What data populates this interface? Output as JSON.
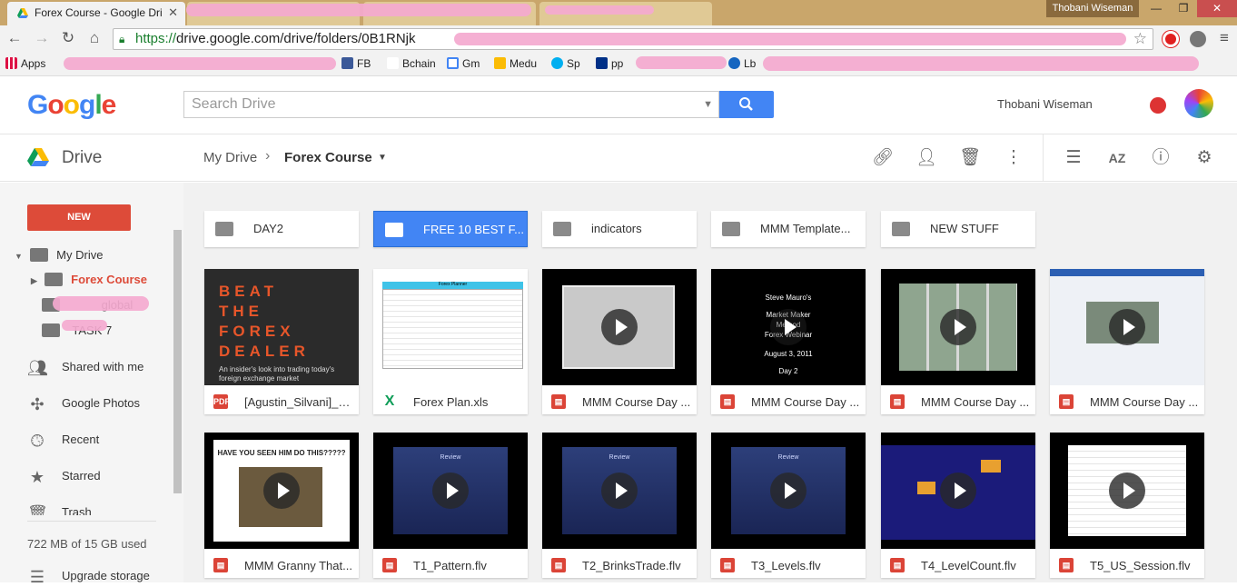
{
  "browser": {
    "active_tab_title": "Forex Course - Google Dri",
    "window_user": "Thobani Wiseman",
    "url_secure": "https://",
    "url_rest": "drive.google.com/drive/folders/0B1RNjk",
    "bookmarks_apps": "Apps",
    "bookmarks": [
      "FB",
      "Bchain",
      "Gm",
      "Medu",
      "Sp",
      "pp",
      "Lb"
    ]
  },
  "header": {
    "logo": "Google",
    "search_placeholder": "Search Drive",
    "user_name": "Thobani Wiseman"
  },
  "drive": {
    "product_label": "Drive",
    "breadcrumb_root": "My Drive",
    "breadcrumb_current": "Forex Course"
  },
  "sidebar": {
    "new_label": "NEW",
    "tree_root": "My Drive",
    "tree_current": "Forex Course",
    "tree_child2": "global",
    "tree_child3": "TASK 7",
    "items": [
      "Shared with me",
      "Google Photos",
      "Recent",
      "Starred",
      "Trash"
    ],
    "storage_text": "722 MB of 15 GB used",
    "upgrade_label": "Upgrade storage"
  },
  "folders": [
    "DAY2",
    "FREE 10 BEST F...",
    "indicators",
    "MMM Template...",
    "NEW STUFF"
  ],
  "files_row1": [
    "[Agustin_Silvani]_B...",
    "Forex Plan.xls",
    "MMM Course Day ...",
    "MMM Course Day ...",
    "MMM Course Day ...",
    "MMM Course Day ..."
  ],
  "files_row2": [
    "MMM Granny That...",
    "T1_Pattern.flv",
    "T2_BrinksTrade.flv",
    "T3_Levels.flv",
    "T4_LevelCount.flv",
    "T5_US_Session.flv"
  ],
  "thumbs": {
    "book_title": "BEAT THE FOREX DEALER",
    "book_subtitle": "An insider's look into trading today's foreign exchange market",
    "sheet_title": "Forex Planner",
    "mauro_lines": [
      "Steve Mauro's",
      "Market Maker Method",
      "Forex Webinar",
      "August 3, 2011",
      "Day 2"
    ],
    "granny_title": "HAVE YOU SEEN HIM DO THIS?????",
    "review_title": "Review"
  },
  "colors": {
    "drive_blue": "#4285f4",
    "new_red": "#dd4b39",
    "video_red": "#db4437",
    "excel_green": "#0f9d58"
  }
}
